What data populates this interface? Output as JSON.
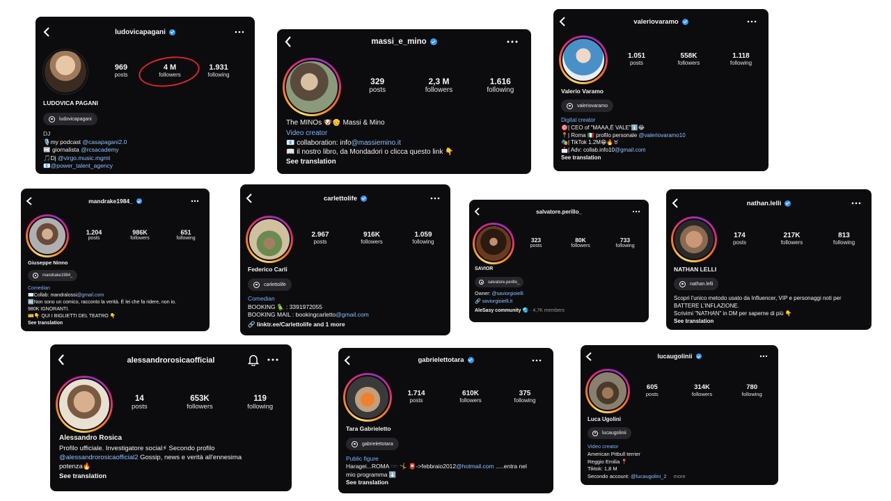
{
  "colors": {
    "background": "#ffffff",
    "card": "#0c0c0e",
    "verified": "#3897f0",
    "link": "#7bb6ff",
    "annotation": "#d8262e"
  },
  "icons": {
    "back": "chevron-left-icon",
    "more": "more-horizontal-icon",
    "verified": "verified-badge-icon",
    "threads": "threads-icon",
    "bell": "bell-icon",
    "link": "link-icon"
  },
  "profiles": [
    {
      "username": "ludovicapagani",
      "verified": true,
      "stats": [
        {
          "n": "969",
          "l": "posts"
        },
        {
          "n": "4 M",
          "l": "followers"
        },
        {
          "n": "1.931",
          "l": "following"
        }
      ],
      "name": "LUDOVICA PAGANI",
      "threads": "ludovicapagani",
      "bio": [
        "DJ",
        "🎙️my podcast @casapagani2.0",
        "📰 giornalista @rcsacademy",
        "🎵Dj @virgo.music.mgmt",
        "📧@power_talent_agency"
      ]
    },
    {
      "username": "massi_e_mino",
      "verified": true,
      "stats": [
        {
          "n": "329",
          "l": "posts"
        },
        {
          "n": "2,3 M",
          "l": "followers"
        },
        {
          "n": "1.616",
          "l": "following"
        }
      ],
      "name": "The MINOs 🐶👴  Massi & Mino",
      "bio": [
        "Video creator",
        "📧 collaboration: info@massiemino.it",
        "📖 il nostro libro, da Mondadori o clicca questo link 👇"
      ],
      "see": "See translation"
    },
    {
      "username": "valeriovaramo",
      "verified": true,
      "stats": [
        {
          "n": "1.051",
          "l": "posts"
        },
        {
          "n": "558K",
          "l": "followers"
        },
        {
          "n": "1.118",
          "l": "following"
        }
      ],
      "name": "Valerio Varamo",
      "threads": "valeriovaramo",
      "bio": [
        "Digital creator",
        "🎯| CEO of \"MAAA,È VALE\"ℹ️😂",
        "📍| Roma 🇮🇹 profilo personale @valeriovaramo10",
        "🎭| TikTok 1.2M😁🔥♉",
        "📩| Adv: collab.info10@gmail.com"
      ],
      "see": "See translation"
    },
    {
      "username": "mandrake1984_",
      "verified": true,
      "stats": [
        {
          "n": "1.204",
          "l": "posts"
        },
        {
          "n": "986K",
          "l": "followers"
        },
        {
          "n": "651",
          "l": "following"
        }
      ],
      "name": "Giuseppe Ninno",
      "threads": "mandrake1984_",
      "bio": [
        "Comedian",
        "✉️Collab: mandralossi@gmail.com",
        "🆖Non sono un comico, racconto la verità. È lei che fa ridere, non io.",
        "980K IGNORANTI.",
        "🎫👇 QUI I BIGLIETTI DEL TEATRO 👇"
      ],
      "see": "See translation"
    },
    {
      "username": "carlettolife",
      "verified": true,
      "stats": [
        {
          "n": "2.967",
          "l": "posts"
        },
        {
          "n": "916K",
          "l": "followers"
        },
        {
          "n": "1.059",
          "l": "following"
        }
      ],
      "name": "Federico Carli",
      "threads": "carlettolife",
      "bio": [
        "Comedian",
        "BOOKING 🦜 : 3391972055",
        "BOOKING MAIL : bookingcarletto@gmail.com"
      ],
      "linktext": "linktr.ee/Carlettolife and 1 more"
    },
    {
      "username": "salvatore.perillo_",
      "verified": false,
      "stats": [
        {
          "n": "323",
          "l": "posts"
        },
        {
          "n": "80K",
          "l": "followers"
        },
        {
          "n": "733",
          "l": "following"
        }
      ],
      "name": "SAVIOR",
      "threads": "salvatore.perillo_",
      "bio": [
        "Owner: @saviorgioielli"
      ],
      "linktext": "saviorgioielli.it",
      "community": "AleSasy community 🌏",
      "members": "· 4,7K members"
    },
    {
      "username": "nathan.lelli",
      "verified": true,
      "stats": [
        {
          "n": "174",
          "l": "posts"
        },
        {
          "n": "217K",
          "l": "followers"
        },
        {
          "n": "813",
          "l": "following"
        }
      ],
      "name": "NATHAN LELLI",
      "threads": "nathan.lelli",
      "bio": [
        "Scopri l'unico metodo usato da Influencer, VIP e personaggi noti per",
        "BATTERE L'INFLAZIONE.",
        "Scrivimi \"NATHAN\" in DM per saperne di più 👇"
      ],
      "see": "See translation"
    },
    {
      "username": "alessandrorosicaofficial",
      "verified": false,
      "stats": [
        {
          "n": "14",
          "l": "posts"
        },
        {
          "n": "653K",
          "l": "followers"
        },
        {
          "n": "119",
          "l": "following"
        }
      ],
      "name": "Alessandro Rosica",
      "bio": [
        "Profilo ufficiale. Investigatore social⚡ Secondo profilo",
        "@alessandrorosicaofficial2 Gossip, news e verità all'ennesima",
        "potenza🔥"
      ],
      "see": "See translation"
    },
    {
      "username": "gabrielettotara",
      "verified": true,
      "stats": [
        {
          "n": "1.714",
          "l": "posts"
        },
        {
          "n": "610K",
          "l": "followers"
        },
        {
          "n": "375",
          "l": "following"
        }
      ],
      "name": "Tara Gabrieletto",
      "threads": "gabrielettotara",
      "bio": [
        "Public figure",
        "Haragei...ROMA 🕶️ 🤸 📮->febbraio2012@hotmail.com .....entra nel",
        "mio programma ⬇️"
      ],
      "see": "See translation"
    },
    {
      "username": "lucaugolinii",
      "verified": true,
      "stats": [
        {
          "n": "605",
          "l": "posts"
        },
        {
          "n": "314K",
          "l": "followers"
        },
        {
          "n": "780",
          "l": "following"
        }
      ],
      "name": "Luca Ugolini",
      "threads": "lucaugolinii",
      "bio": [
        "Video creator",
        "American Pitbull terrier",
        "Reggio Emilia 📍",
        "Tiktok: 1,8 M",
        "Secondo account: @lucaugolini_2"
      ],
      "more": "more"
    }
  ]
}
